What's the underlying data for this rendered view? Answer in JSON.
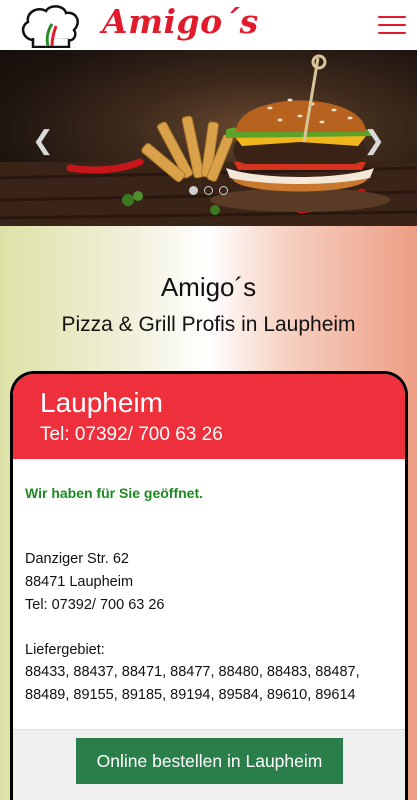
{
  "header": {
    "logo_text": "Amigo´s",
    "menu_icon": "hamburger-icon",
    "brand_color": "#e21b2c"
  },
  "hero": {
    "prev_icon": "chevron-left-icon",
    "next_icon": "chevron-right-icon",
    "prev_glyph": "❮",
    "next_glyph": "❯",
    "slides_count": 3,
    "active_slide": 1
  },
  "intro": {
    "title": "Amigo´s",
    "subtitle": "Pizza & Grill Profis in Laupheim"
  },
  "location": {
    "city": "Laupheim",
    "phone_header": "Tel: 07392/ 700 63 26",
    "open_status": "Wir haben für Sie geöffnet.",
    "street": "Danziger Str. 62",
    "zip_city": "88471 Laupheim",
    "phone": "Tel: 07392/ 700 63 26",
    "delivery_label": "Liefergebiet:",
    "delivery_line1": "88433, 88437, 88471, 88477, 88480, 88483, 88487,",
    "delivery_line2": "88489, 89155, 89185, 89194, 89584, 89610, 89614",
    "order_button": "Online bestellen in Laupheim",
    "header_color": "#ee303d",
    "open_color": "#1b8b1f",
    "button_color": "#2a7e4a"
  }
}
